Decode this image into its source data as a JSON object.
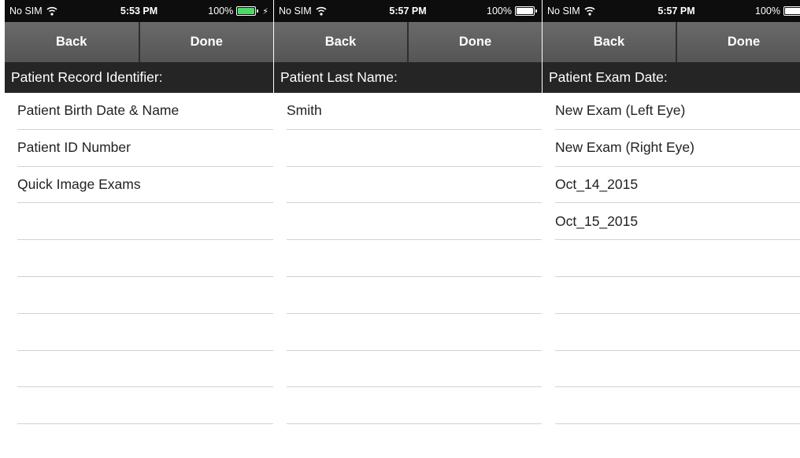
{
  "screens": [
    {
      "status": {
        "carrier": "No SIM",
        "time": "5:53 PM",
        "battery": "100%",
        "battery_color": "#4cd964",
        "charging": true
      },
      "nav": {
        "back_label": "Back",
        "done_label": "Done"
      },
      "header": "Patient Record Identifier:",
      "rows": [
        "Patient Birth Date & Name",
        "Patient ID Number",
        "Quick Image Exams",
        "",
        "",
        "",
        "",
        "",
        ""
      ]
    },
    {
      "status": {
        "carrier": "No SIM",
        "time": "5:57 PM",
        "battery": "100%",
        "battery_color": "#ffffff",
        "charging": false
      },
      "nav": {
        "back_label": "Back",
        "done_label": "Done"
      },
      "header": "Patient Last Name:",
      "rows": [
        "Smith",
        "",
        "",
        "",
        "",
        "",
        "",
        "",
        ""
      ]
    },
    {
      "status": {
        "carrier": "No SIM",
        "time": "5:57 PM",
        "battery": "100%",
        "battery_color": "#ffffff",
        "charging": false
      },
      "nav": {
        "back_label": "Back",
        "done_label": "Done"
      },
      "header": "Patient Exam Date:",
      "rows": [
        "New Exam (Left Eye)",
        "New Exam (Right Eye)",
        "Oct_14_2015",
        "Oct_15_2015",
        "",
        "",
        "",
        "",
        ""
      ]
    }
  ]
}
